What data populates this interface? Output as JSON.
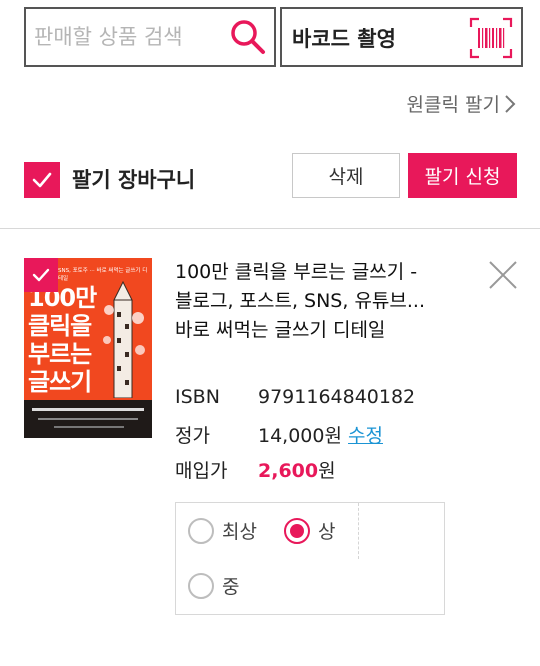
{
  "search": {
    "placeholder": "판매할 상품 검색",
    "value": "",
    "barcode_label": "바코드 촬영"
  },
  "oneclick": {
    "label": "원클릭 팔기"
  },
  "cart": {
    "title": "팔기 장바구니",
    "checked": true,
    "delete_label": "삭제",
    "sell_label": "팔기 신청"
  },
  "book": {
    "selected": true,
    "cover": {
      "tagline": "SNS, 포토주 ··· 바로 써먹는 글쓰기 디테일",
      "title_lines": [
        "100만",
        "클릭을",
        "부르는",
        "글쓰기"
      ]
    },
    "title": "100만 클릭을 부르는 글쓰기 - 블로그, 포스트, SNS, 유튜브... 바로 써먹는 글쓰기 디테일",
    "isbn_label": "ISBN",
    "isbn": "9791164840182",
    "list_price_label": "정가",
    "list_price": "14,000원",
    "edit_label": "수정",
    "buy_price_label": "매입가",
    "buy_price_value": "2,600",
    "buy_price_unit": "원"
  },
  "conditions": {
    "options": [
      "최상",
      "상",
      "중"
    ],
    "selected": "상"
  },
  "colors": {
    "accent": "#e8185a",
    "link": "#1b94d4",
    "cover": "#f1481f"
  },
  "icons": [
    "search-icon",
    "barcode-icon",
    "chevron-right-icon",
    "check-icon",
    "close-icon"
  ]
}
